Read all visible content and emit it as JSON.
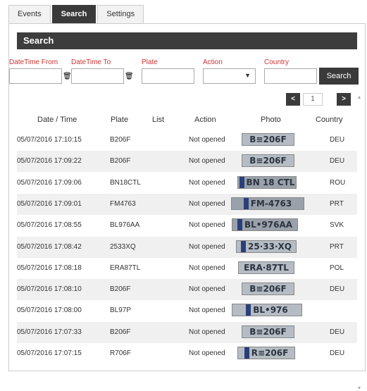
{
  "tabs": [
    {
      "label": "Events",
      "active": false
    },
    {
      "label": "Search",
      "active": true
    },
    {
      "label": "Settings",
      "active": false
    }
  ],
  "panel_title": "Search",
  "filters": {
    "datetime_from_label": "DateTime From",
    "datetime_to_label": "DateTime To",
    "plate_label": "Plate",
    "action_label": "Action",
    "country_label": "Country",
    "datetime_from_value": "",
    "datetime_to_value": "",
    "plate_value": "",
    "action_value": "",
    "country_value": "",
    "search_button": "Search"
  },
  "pager": {
    "prev": "<",
    "page": "1",
    "next": ">"
  },
  "columns": [
    "Date / Time",
    "Plate",
    "List",
    "Action",
    "Photo",
    "Country"
  ],
  "rows": [
    {
      "datetime": "05/07/2016 17:10:15",
      "plate": "B206F",
      "list": "",
      "action": "Not opened",
      "photo_text": "B≡206F",
      "country": "DEU"
    },
    {
      "datetime": "05/07/2016 17:09:22",
      "plate": "B206F",
      "list": "",
      "action": "Not opened",
      "photo_text": "B≡206F",
      "country": "DEU"
    },
    {
      "datetime": "05/07/2016 17:09:06",
      "plate": "BN18CTL",
      "list": "",
      "action": "Not opened",
      "photo_text": "BN 18 CTL",
      "country": "ROU"
    },
    {
      "datetime": "05/07/2016 17:09:01",
      "plate": "FM4763",
      "list": "",
      "action": "Not opened",
      "photo_text": "FM-4763",
      "country": "PRT"
    },
    {
      "datetime": "05/07/2016 17:08:55",
      "plate": "BL976AA",
      "list": "",
      "action": "Not opened",
      "photo_text": "BL•976AA",
      "country": "SVK"
    },
    {
      "datetime": "05/07/2016 17:08:42",
      "plate": "2533XQ",
      "list": "",
      "action": "Not opened",
      "photo_text": "25·33·XQ",
      "country": "PRT"
    },
    {
      "datetime": "05/07/2016 17:08:18",
      "plate": "ERA87TL",
      "list": "",
      "action": "Not opened",
      "photo_text": "ERA·87TL",
      "country": "POL"
    },
    {
      "datetime": "05/07/2016 17:08:10",
      "plate": "B206F",
      "list": "",
      "action": "Not opened",
      "photo_text": "B≡206F",
      "country": "DEU"
    },
    {
      "datetime": "05/07/2016 17:08:00",
      "plate": "BL97P",
      "list": "",
      "action": "Not opened",
      "photo_text": "BL•976",
      "country": ""
    },
    {
      "datetime": "05/07/2016 17:07:33",
      "plate": "B206F",
      "list": "",
      "action": "Not opened",
      "photo_text": "B≡206F",
      "country": "DEU"
    },
    {
      "datetime": "05/07/2016 17:07:15",
      "plate": "R706F",
      "list": "",
      "action": "Not opened",
      "photo_text": "R≡206F",
      "country": "DEU"
    }
  ],
  "colors": {
    "accent": "#3a3a3a",
    "label_red": "#cc3333",
    "row_alt": "#f0f0f0"
  }
}
